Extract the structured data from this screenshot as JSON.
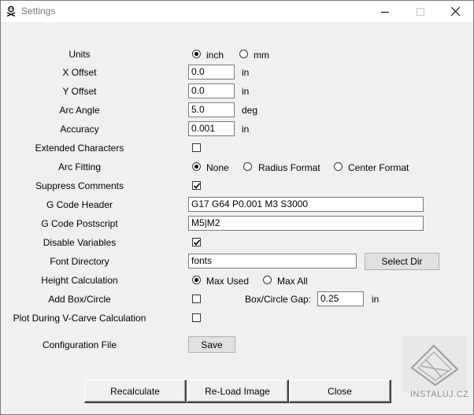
{
  "window": {
    "title": "Settings"
  },
  "labels": {
    "units": "Units",
    "x_offset": "X Offset",
    "y_offset": "Y Offset",
    "arc_angle": "Arc Angle",
    "accuracy": "Accuracy",
    "extended_characters": "Extended Characters",
    "arc_fitting": "Arc Fitting",
    "suppress_comments": "Suppress Comments",
    "gcode_header": "G Code Header",
    "gcode_postscript": "G Code Postscript",
    "disable_variables": "Disable Variables",
    "font_directory": "Font Directory",
    "height_calculation": "Height Calculation",
    "add_box_circle": "Add Box/Circle",
    "plot_during_vcarve": "Plot During V-Carve Calculation",
    "configuration_file": "Configuration File",
    "box_circle_gap": "Box/Circle Gap:"
  },
  "units": {
    "options": [
      "inch",
      "mm"
    ],
    "selected": "inch",
    "x_offset_unit": "in",
    "y_offset_unit": "in",
    "arc_angle_unit": "deg",
    "accuracy_unit": "in",
    "gap_unit": "in"
  },
  "values": {
    "x_offset": "0.0",
    "y_offset": "0.0",
    "arc_angle": "5.0",
    "accuracy": "0.001",
    "gcode_header": "G17 G64 P0.001 M3 S3000",
    "gcode_postscript": "M5|M2",
    "font_directory": "fonts",
    "box_circle_gap": "0.25"
  },
  "checkboxes": {
    "extended_characters": false,
    "suppress_comments": true,
    "disable_variables": true,
    "add_box_circle": false,
    "plot_during_vcarve": false
  },
  "arc_fitting": {
    "options": [
      "None",
      "Radius Format",
      "Center Format"
    ],
    "selected": "None"
  },
  "height_calculation": {
    "options": [
      "Max Used",
      "Max All"
    ],
    "selected": "Max Used"
  },
  "buttons": {
    "select_dir": "Select Dir",
    "save": "Save",
    "recalculate": "Recalculate",
    "reload_image": "Re-Load Image",
    "close": "Close"
  },
  "watermark": {
    "text": "INSTALUJ.CZ"
  }
}
